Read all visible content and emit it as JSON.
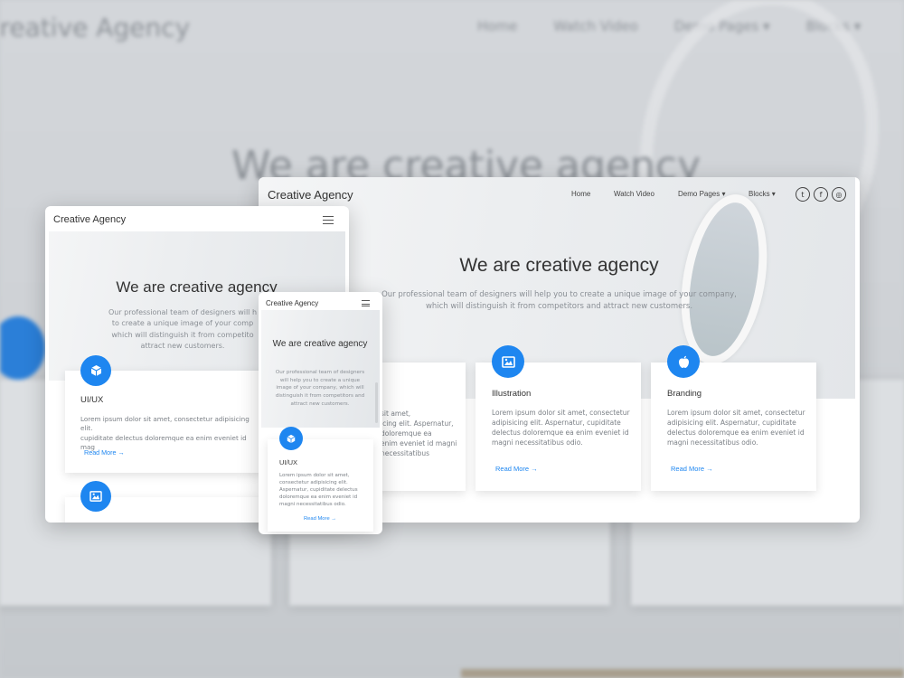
{
  "brand": "Creative Agency",
  "nav": {
    "home": "Home",
    "watch_video": "Watch Video",
    "demo_pages": "Demo Pages ▾",
    "blocks": "Blocks ▾"
  },
  "social_icons": [
    "twitter-icon",
    "facebook-icon",
    "instagram-icon"
  ],
  "hero": {
    "title": "We are creative agency",
    "subtitle": "Our professional team of designers will help you to create a unique image of your company, which will distinguish it from competitors and attract new customers."
  },
  "cards": [
    {
      "icon": "cube-icon",
      "title": "UI/UX",
      "text": "Lorem ipsum dolor sit amet, consectetur adipisicing elit. Aspernatur, cupiditate delectus doloremque ea enim eveniet id magni necessitatibus odio.",
      "link": "Read More →"
    },
    {
      "icon": "image-icon",
      "title": "Illustration",
      "text": "Lorem ipsum dolor sit amet, consectetur adipisicing elit. Aspernatur, cupiditate delectus doloremque ea enim eveniet id magni necessitatibus odio.",
      "link": "Read More →"
    },
    {
      "icon": "apple-icon",
      "title": "Branding",
      "text": "Lorem ipsum dolor sit amet, consectetur adipisicing elit. Aspernatur, cupiditate delectus doloremque ea enim eveniet id magni necessitatibus odio.",
      "link": "Read More →"
    }
  ],
  "partial": {
    "desktop_card1_text": "sit amet,\nicing elit. Aspernatur,\ndoloremque ea\nenim eveniet id magni necessitatibus",
    "tablet_subtitle": "Our professional team of designers will h\nto create a unique image of your comp\nwhich will distinguish it from competito\nattract new customers.",
    "tablet_card_text": "Lorem ipsum dolor sit amet, consectetur adipisicing elit.\ncupiditate delectus doloremque ea enim eveniet id mag"
  },
  "colors": {
    "accent": "#1e86f0",
    "text": "#333333",
    "muted": "#7a7f85"
  }
}
